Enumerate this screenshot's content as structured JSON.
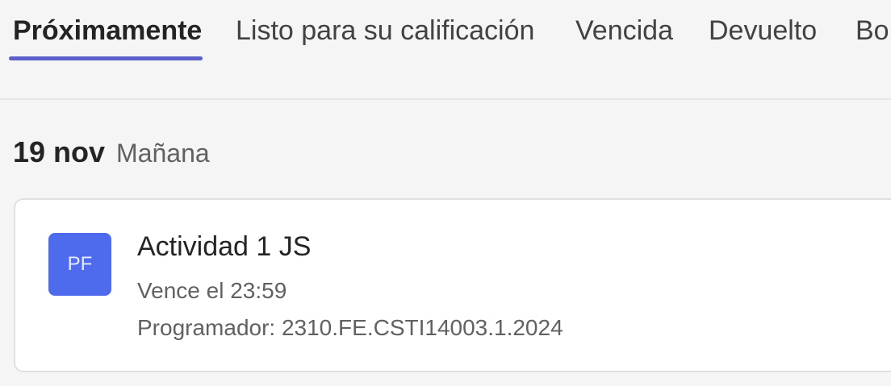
{
  "tabs": [
    {
      "label": "Próximamente",
      "active": true
    },
    {
      "label": "Listo para su calificación",
      "active": false
    },
    {
      "label": "Vencida",
      "active": false
    },
    {
      "label": "Devuelto",
      "active": false
    },
    {
      "label": "Bo",
      "active": false
    }
  ],
  "colors": {
    "accent": "#5b5fc7",
    "avatar_bg": "#4f6bed",
    "page_bg": "#f5f5f5"
  },
  "group": {
    "date": "19 nov",
    "relative": "Mañana"
  },
  "assignment": {
    "avatar_initials": "PF",
    "title": "Actividad 1 JS",
    "due": "Vence el 23:59",
    "course": "Programador: 2310.FE.CSTI14003.1.2024"
  }
}
